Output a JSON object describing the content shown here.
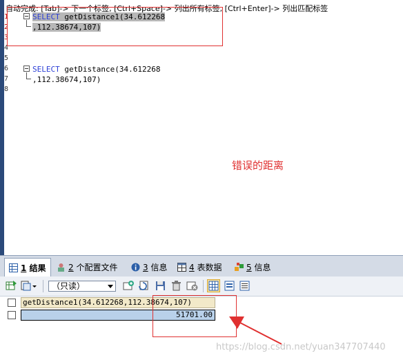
{
  "editor": {
    "hint": "自动完成: [Tab]-> 下一个标签, [Ctrl+Space]-> 列出所有标签, [Ctrl+Enter]-> 列出匹配标签",
    "line_numbers": [
      "1",
      "2",
      "3",
      "4",
      "5",
      "6",
      "7",
      "8"
    ],
    "statement1": {
      "keyword": "SELECT",
      "line1_rest": " getDistance1(34.612268",
      "line2": ",112.38674,107)"
    },
    "statement2": {
      "keyword": "SELECT",
      "line1_rest": " getDistance(34.612268",
      "line2": ",112.38674,107)"
    },
    "annotation": "错误的距离"
  },
  "tabs": [
    {
      "num": "1",
      "label": " 结果"
    },
    {
      "num": "2",
      "label": " 个配置文件"
    },
    {
      "num": "3",
      "label": " 信息"
    },
    {
      "num": "4",
      "label": " 表数据"
    },
    {
      "num": "5",
      "label": " 信息"
    }
  ],
  "toolbar": {
    "readonly_value": "（只读）"
  },
  "grid": {
    "column_header": "getDistance1(34.612268,112.38674,107)",
    "value": "51701.00"
  },
  "watermark": "https://blog.csdn.net/yuan347707440",
  "colors": {
    "keyword": "#2b3ed6",
    "annotation": "#e03030",
    "selected_cell": "#b9d1ea",
    "header_cell": "#f2e9c9"
  }
}
